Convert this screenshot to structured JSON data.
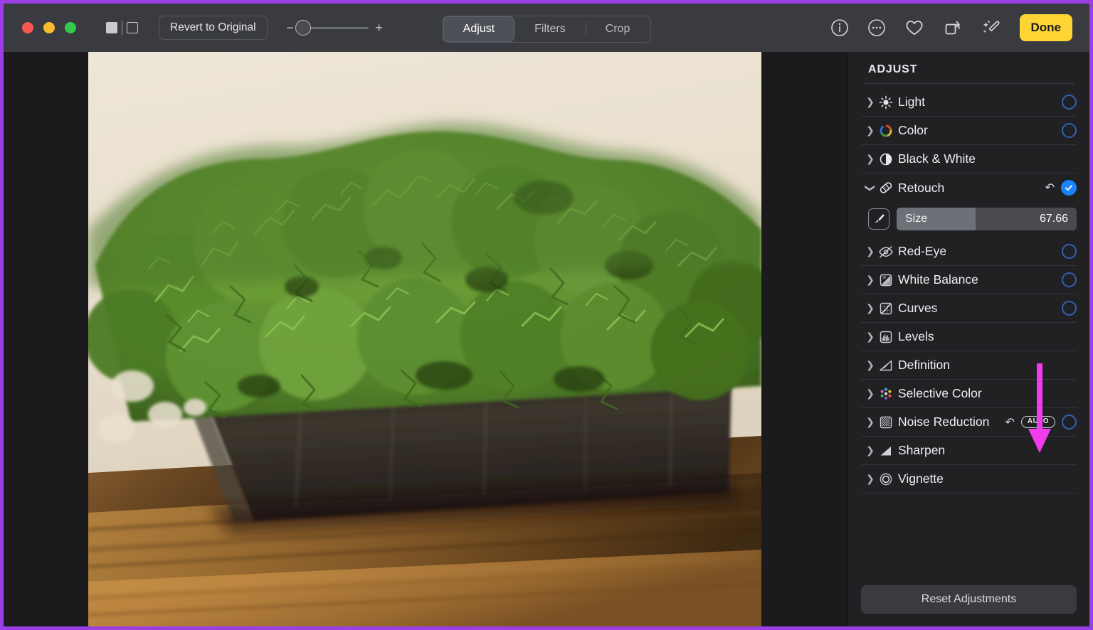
{
  "window": {
    "traffic_lights": [
      {
        "name": "close",
        "color": "#f5594e"
      },
      {
        "name": "minimize",
        "color": "#f7bd2e"
      },
      {
        "name": "maximize",
        "color": "#34c749"
      }
    ],
    "split_view_icon": "split-view-icon"
  },
  "toolbar": {
    "revert_label": "Revert to Original",
    "zoom": {
      "minus": "−",
      "plus": "+",
      "value_percent": 0
    },
    "tabs": [
      {
        "label": "Adjust",
        "active": true
      },
      {
        "label": "Filters",
        "active": false
      },
      {
        "label": "Crop",
        "active": false
      }
    ],
    "icons": [
      {
        "name": "info-icon",
        "glyph": "i"
      },
      {
        "name": "more-options-icon",
        "glyph": "⋯"
      },
      {
        "name": "favorite-heart-icon",
        "glyph": "♡"
      },
      {
        "name": "rotate-icon",
        "glyph": "↺"
      },
      {
        "name": "auto-enhance-magic-wand-icon",
        "glyph": "✨"
      }
    ],
    "done_label": "Done"
  },
  "sidebar": {
    "title": "ADJUST",
    "items": [
      {
        "label": "Light",
        "icon": "brightness-sun-icon",
        "expanded": false,
        "toggle": "ring"
      },
      {
        "label": "Color",
        "icon": "color-wheel-icon",
        "expanded": false,
        "toggle": "ring"
      },
      {
        "label": "Black & White",
        "icon": "black-and-white-icon",
        "expanded": false,
        "toggle": "none"
      },
      {
        "label": "Retouch",
        "icon": "retouch-bandage-icon",
        "expanded": true,
        "toggle": "check",
        "revert": true
      },
      {
        "label": "Red-Eye",
        "icon": "red-eye-icon",
        "expanded": false,
        "toggle": "ring"
      },
      {
        "label": "White Balance",
        "icon": "white-balance-icon",
        "expanded": false,
        "toggle": "ring"
      },
      {
        "label": "Curves",
        "icon": "curves-icon",
        "expanded": false,
        "toggle": "ring"
      },
      {
        "label": "Levels",
        "icon": "levels-icon",
        "expanded": false,
        "toggle": "none"
      },
      {
        "label": "Definition",
        "icon": "definition-icon",
        "expanded": false,
        "toggle": "none"
      },
      {
        "label": "Selective Color",
        "icon": "selective-color-icon",
        "expanded": false,
        "toggle": "none"
      },
      {
        "label": "Noise Reduction",
        "icon": "noise-reduction-icon",
        "expanded": false,
        "toggle": "ring",
        "revert": true,
        "auto_badge": "AUTO"
      },
      {
        "label": "Sharpen",
        "icon": "sharpen-icon",
        "expanded": false,
        "toggle": "none"
      },
      {
        "label": "Vignette",
        "icon": "vignette-icon",
        "expanded": false,
        "toggle": "none"
      }
    ],
    "retouch_controls": {
      "brush_icon": "brush-icon",
      "size_label": "Size",
      "size_value": "67.66",
      "size_fill_percent": 44
    },
    "reset_label": "Reset Adjustments"
  },
  "annotation": {
    "arrow_color": "#f03cec",
    "points_at": "AUTO"
  },
  "colors": {
    "accent_done": "#fcd535",
    "toggle_on": "#1a84ff",
    "toggle_ring": "#2f63b4",
    "annotation_border": "#9c3ee6",
    "titlebar_bg": "#3a3b40",
    "sidebar_bg": "#212124",
    "canvas_bg": "#1b1b1d"
  },
  "photo": {
    "description": "green-reindeer-moss-in-dark-planter-on-wooden-table"
  }
}
